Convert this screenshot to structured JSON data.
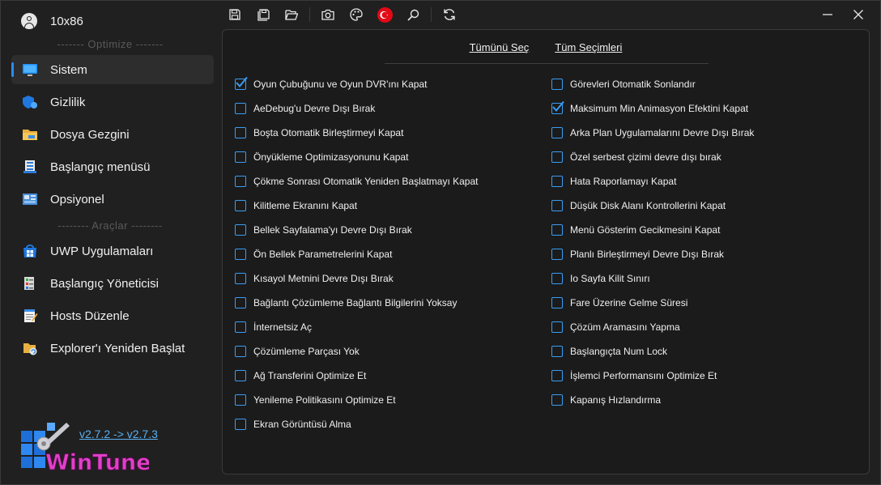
{
  "user": {
    "name": "10x86"
  },
  "sidebar": {
    "section_optimize": "------- Optimize -------",
    "section_tools": "-------- Araçlar --------",
    "items": [
      {
        "label": "Sistem",
        "icon": "monitor-icon"
      },
      {
        "label": "Gizlilik",
        "icon": "shield-icon"
      },
      {
        "label": "Dosya Gezgini",
        "icon": "folder-icon"
      },
      {
        "label": "Başlangıç menüsü",
        "icon": "start-menu-icon"
      },
      {
        "label": "Opsiyonel",
        "icon": "control-panel-icon"
      },
      {
        "label": "UWP Uygulamaları",
        "icon": "store-icon"
      },
      {
        "label": "Başlangıç Yöneticisi",
        "icon": "startup-manager-icon"
      },
      {
        "label": "Hosts Düzenle",
        "icon": "notepad-icon"
      },
      {
        "label": "Explorer'ı Yeniden Başlat",
        "icon": "explorer-restart-icon"
      }
    ],
    "version_link": "v2.7.2 -> v2.7.3",
    "logo_text": "WinTune"
  },
  "toolbar": {
    "buttons": [
      "save-icon",
      "save-all-icon",
      "open-folder-icon",
      "camera-icon",
      "palette-icon",
      "turkey-flag-icon",
      "search-icon",
      "refresh-icon"
    ]
  },
  "window": {
    "controls": [
      "minimize-icon",
      "close-icon"
    ]
  },
  "main": {
    "select_all": "Tümünü Seç",
    "all_selections": "Tüm Seçimleri ",
    "left_options": [
      {
        "label": "Oyun Çubuğunu ve Oyun DVR'ını Kapat",
        "checked": true
      },
      {
        "label": "AeDebug'u Devre Dışı Bırak",
        "checked": false
      },
      {
        "label": "Boşta Otomatik Birleştirmeyi Kapat",
        "checked": false
      },
      {
        "label": "Önyükleme Optimizasyonunu Kapat",
        "checked": false
      },
      {
        "label": "Çökme Sonrası Otomatik Yeniden Başlatmayı Kapat",
        "checked": false
      },
      {
        "label": "Kilitleme Ekranını Kapat",
        "checked": false
      },
      {
        "label": "Bellek Sayfalama'yı Devre Dışı Bırak",
        "checked": false
      },
      {
        "label": "Ön Bellek Parametrelerini Kapat",
        "checked": false
      },
      {
        "label": "Kısayol Metnini Devre Dışı Bırak",
        "checked": false
      },
      {
        "label": "Bağlantı Çözümleme Bağlantı Bilgilerini Yoksay",
        "checked": false
      },
      {
        "label": "İnternetsiz Aç",
        "checked": false
      },
      {
        "label": "Çözümleme Parçası Yok",
        "checked": false
      },
      {
        "label": "Ağ Transferini Optimize Et",
        "checked": false
      },
      {
        "label": "Yenileme Politikasını Optimize Et",
        "checked": false
      },
      {
        "label": "Ekran Görüntüsü Alma",
        "checked": false
      }
    ],
    "right_options": [
      {
        "label": "Görevleri Otomatik Sonlandır",
        "checked": false
      },
      {
        "label": "Maksimum Min Animasyon Efektini Kapat",
        "checked": true
      },
      {
        "label": "Arka Plan Uygulamalarını Devre Dışı Bırak",
        "checked": false
      },
      {
        "label": "Özel serbest çizimi devre dışı bırak",
        "checked": false
      },
      {
        "label": "Hata Raporlamayı Kapat",
        "checked": false
      },
      {
        "label": "Düşük Disk Alanı Kontrollerini Kapat",
        "checked": false
      },
      {
        "label": "Menü Gösterim Gecikmesini Kapat",
        "checked": false
      },
      {
        "label": "Planlı Birleştirmeyi Devre Dışı Bırak",
        "checked": false
      },
      {
        "label": "Io Sayfa Kilit Sınırı",
        "checked": false
      },
      {
        "label": "Fare Üzerine Gelme Süresi",
        "checked": false
      },
      {
        "label": "Çözüm Aramasını Yapma",
        "checked": false
      },
      {
        "label": "Başlangıçta Num Lock",
        "checked": false
      },
      {
        "label": "İşlemci Performansını Optimize Et",
        "checked": false
      },
      {
        "label": "Kapanış Hızlandırma",
        "checked": false
      }
    ]
  },
  "colors": {
    "accent": "#3a9df5",
    "background": "#202020",
    "panel": "#1b1b1b",
    "logo_pink": "#e040c8"
  }
}
